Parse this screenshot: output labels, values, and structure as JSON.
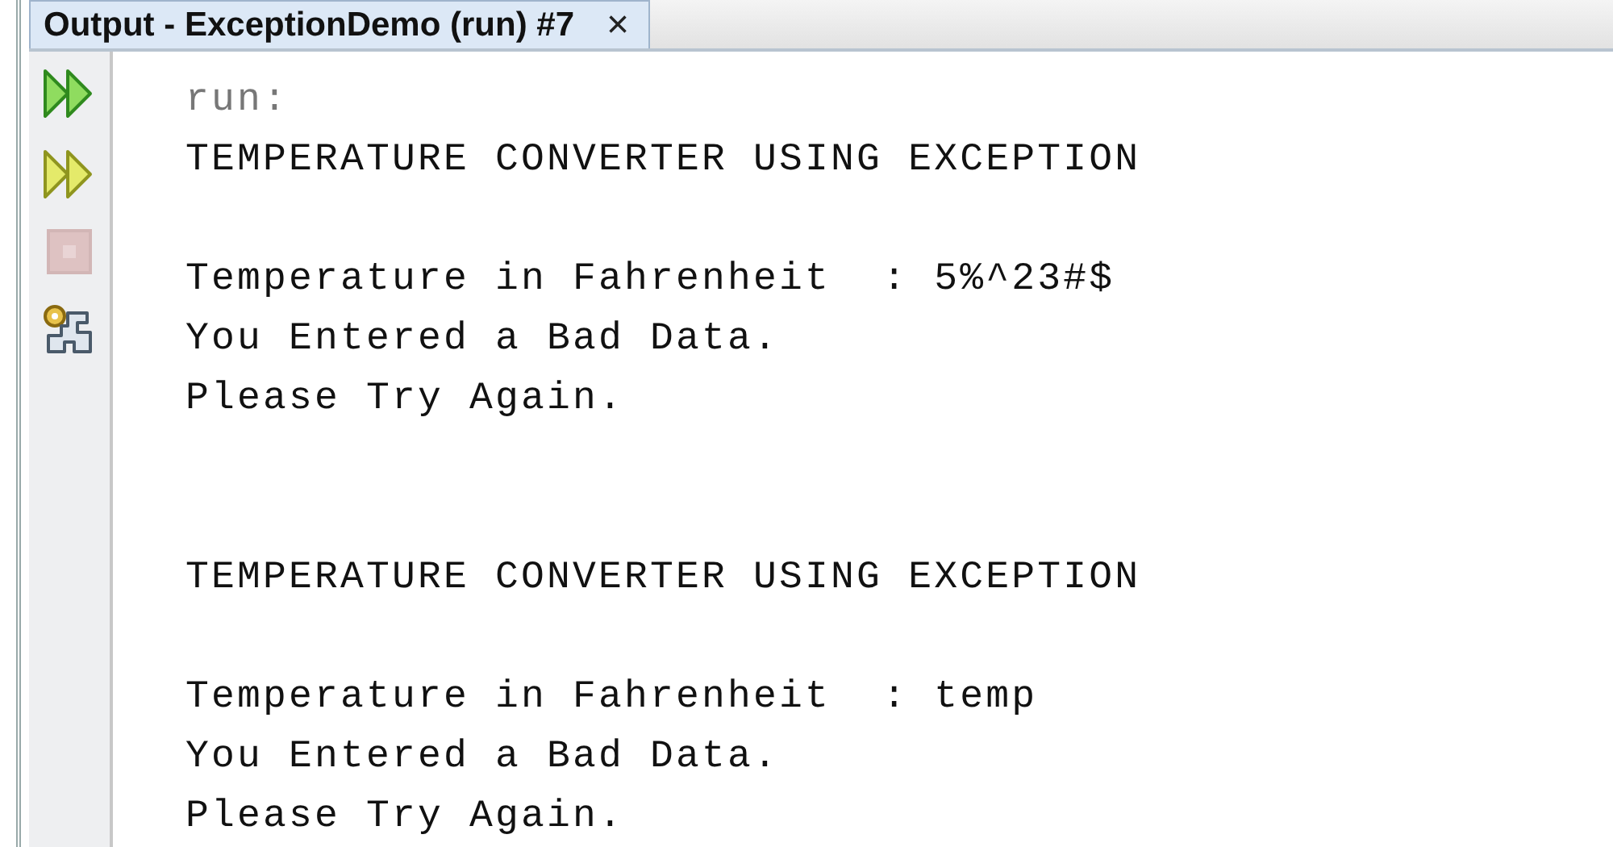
{
  "tab": {
    "title": "Output - ExceptionDemo (run) #7",
    "close": "×",
    "selected": true
  },
  "toolbar": [
    {
      "kind": "rerun",
      "disabled": false
    },
    {
      "kind": "rerun-options",
      "disabled": false
    },
    {
      "kind": "stop",
      "disabled": true
    },
    {
      "kind": "settings",
      "disabled": false
    }
  ],
  "output_lines": [
    {
      "kind": "echo",
      "text": "run:"
    },
    {
      "kind": "output",
      "text": "TEMPERATURE CONVERTER USING EXCEPTION"
    },
    {
      "kind": "blank"
    },
    {
      "kind": "output",
      "text": "Temperature in Fahrenheit  : 5%^23#$"
    },
    {
      "kind": "output",
      "text": "You Entered a Bad Data."
    },
    {
      "kind": "output",
      "text": "Please Try Again."
    },
    {
      "kind": "blank"
    },
    {
      "kind": "blank"
    },
    {
      "kind": "output",
      "text": "TEMPERATURE CONVERTER USING EXCEPTION"
    },
    {
      "kind": "blank"
    },
    {
      "kind": "output",
      "text": "Temperature in Fahrenheit  : temp"
    },
    {
      "kind": "output",
      "text": "You Entered a Bad Data."
    },
    {
      "kind": "output",
      "text": "Please Try Again."
    }
  ]
}
